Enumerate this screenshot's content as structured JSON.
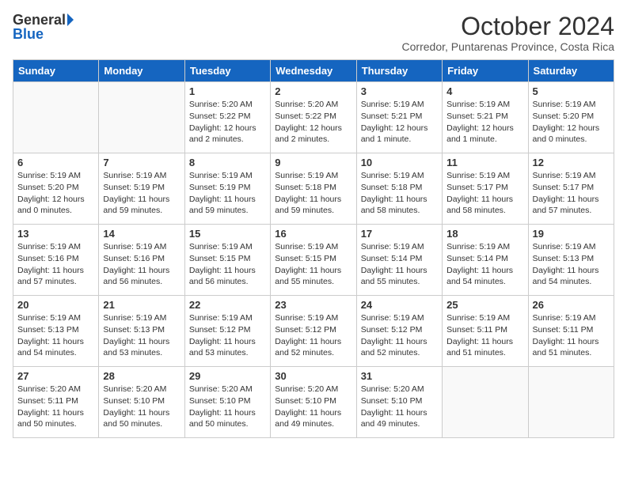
{
  "logo": {
    "general": "General",
    "blue": "Blue"
  },
  "title": "October 2024",
  "location": "Corredor, Puntarenas Province, Costa Rica",
  "days_of_week": [
    "Sunday",
    "Monday",
    "Tuesday",
    "Wednesday",
    "Thursday",
    "Friday",
    "Saturday"
  ],
  "weeks": [
    [
      {
        "day": "",
        "info": ""
      },
      {
        "day": "",
        "info": ""
      },
      {
        "day": "1",
        "info": "Sunrise: 5:20 AM\nSunset: 5:22 PM\nDaylight: 12 hours\nand 2 minutes."
      },
      {
        "day": "2",
        "info": "Sunrise: 5:20 AM\nSunset: 5:22 PM\nDaylight: 12 hours\nand 2 minutes."
      },
      {
        "day": "3",
        "info": "Sunrise: 5:19 AM\nSunset: 5:21 PM\nDaylight: 12 hours\nand 1 minute."
      },
      {
        "day": "4",
        "info": "Sunrise: 5:19 AM\nSunset: 5:21 PM\nDaylight: 12 hours\nand 1 minute."
      },
      {
        "day": "5",
        "info": "Sunrise: 5:19 AM\nSunset: 5:20 PM\nDaylight: 12 hours\nand 0 minutes."
      }
    ],
    [
      {
        "day": "6",
        "info": "Sunrise: 5:19 AM\nSunset: 5:20 PM\nDaylight: 12 hours\nand 0 minutes."
      },
      {
        "day": "7",
        "info": "Sunrise: 5:19 AM\nSunset: 5:19 PM\nDaylight: 11 hours\nand 59 minutes."
      },
      {
        "day": "8",
        "info": "Sunrise: 5:19 AM\nSunset: 5:19 PM\nDaylight: 11 hours\nand 59 minutes."
      },
      {
        "day": "9",
        "info": "Sunrise: 5:19 AM\nSunset: 5:18 PM\nDaylight: 11 hours\nand 59 minutes."
      },
      {
        "day": "10",
        "info": "Sunrise: 5:19 AM\nSunset: 5:18 PM\nDaylight: 11 hours\nand 58 minutes."
      },
      {
        "day": "11",
        "info": "Sunrise: 5:19 AM\nSunset: 5:17 PM\nDaylight: 11 hours\nand 58 minutes."
      },
      {
        "day": "12",
        "info": "Sunrise: 5:19 AM\nSunset: 5:17 PM\nDaylight: 11 hours\nand 57 minutes."
      }
    ],
    [
      {
        "day": "13",
        "info": "Sunrise: 5:19 AM\nSunset: 5:16 PM\nDaylight: 11 hours\nand 57 minutes."
      },
      {
        "day": "14",
        "info": "Sunrise: 5:19 AM\nSunset: 5:16 PM\nDaylight: 11 hours\nand 56 minutes."
      },
      {
        "day": "15",
        "info": "Sunrise: 5:19 AM\nSunset: 5:15 PM\nDaylight: 11 hours\nand 56 minutes."
      },
      {
        "day": "16",
        "info": "Sunrise: 5:19 AM\nSunset: 5:15 PM\nDaylight: 11 hours\nand 55 minutes."
      },
      {
        "day": "17",
        "info": "Sunrise: 5:19 AM\nSunset: 5:14 PM\nDaylight: 11 hours\nand 55 minutes."
      },
      {
        "day": "18",
        "info": "Sunrise: 5:19 AM\nSunset: 5:14 PM\nDaylight: 11 hours\nand 54 minutes."
      },
      {
        "day": "19",
        "info": "Sunrise: 5:19 AM\nSunset: 5:13 PM\nDaylight: 11 hours\nand 54 minutes."
      }
    ],
    [
      {
        "day": "20",
        "info": "Sunrise: 5:19 AM\nSunset: 5:13 PM\nDaylight: 11 hours\nand 54 minutes."
      },
      {
        "day": "21",
        "info": "Sunrise: 5:19 AM\nSunset: 5:13 PM\nDaylight: 11 hours\nand 53 minutes."
      },
      {
        "day": "22",
        "info": "Sunrise: 5:19 AM\nSunset: 5:12 PM\nDaylight: 11 hours\nand 53 minutes."
      },
      {
        "day": "23",
        "info": "Sunrise: 5:19 AM\nSunset: 5:12 PM\nDaylight: 11 hours\nand 52 minutes."
      },
      {
        "day": "24",
        "info": "Sunrise: 5:19 AM\nSunset: 5:12 PM\nDaylight: 11 hours\nand 52 minutes."
      },
      {
        "day": "25",
        "info": "Sunrise: 5:19 AM\nSunset: 5:11 PM\nDaylight: 11 hours\nand 51 minutes."
      },
      {
        "day": "26",
        "info": "Sunrise: 5:19 AM\nSunset: 5:11 PM\nDaylight: 11 hours\nand 51 minutes."
      }
    ],
    [
      {
        "day": "27",
        "info": "Sunrise: 5:20 AM\nSunset: 5:11 PM\nDaylight: 11 hours\nand 50 minutes."
      },
      {
        "day": "28",
        "info": "Sunrise: 5:20 AM\nSunset: 5:10 PM\nDaylight: 11 hours\nand 50 minutes."
      },
      {
        "day": "29",
        "info": "Sunrise: 5:20 AM\nSunset: 5:10 PM\nDaylight: 11 hours\nand 50 minutes."
      },
      {
        "day": "30",
        "info": "Sunrise: 5:20 AM\nSunset: 5:10 PM\nDaylight: 11 hours\nand 49 minutes."
      },
      {
        "day": "31",
        "info": "Sunrise: 5:20 AM\nSunset: 5:10 PM\nDaylight: 11 hours\nand 49 minutes."
      },
      {
        "day": "",
        "info": ""
      },
      {
        "day": "",
        "info": ""
      }
    ]
  ]
}
